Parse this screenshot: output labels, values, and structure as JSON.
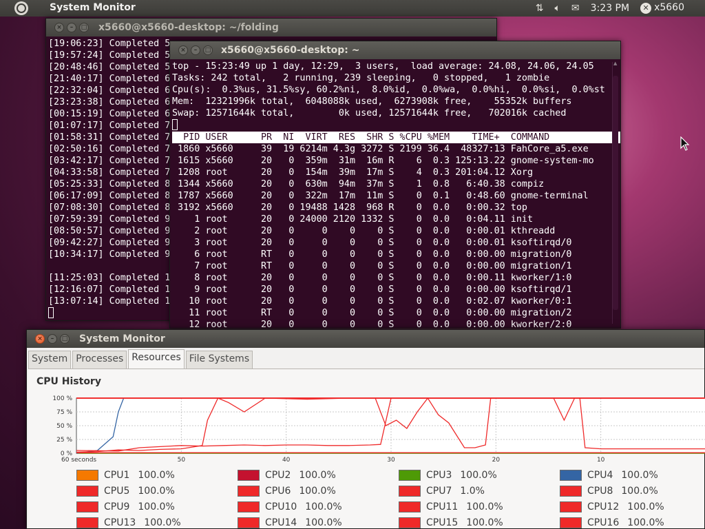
{
  "top_panel": {
    "app_title": "System Monitor",
    "time": "3:23 PM",
    "user": "x5660",
    "icons": [
      "network-icon",
      "volume-icon",
      "mail-icon",
      "session-icon"
    ]
  },
  "terminal_back": {
    "title": "x5660@x5660-desktop: ~/folding",
    "lines": [
      "[19:06:23] Completed 5",
      "[19:57:24] Completed 5",
      "[20:48:46] Completed 5",
      "[21:40:17] Completed 6",
      "[22:32:04] Completed 6",
      "[23:23:38] Completed 6",
      "[00:15:19] Completed 6",
      "[01:07:17] Completed 7",
      "[01:58:31] Completed 7",
      "[02:50:16] Completed 7",
      "[03:42:17] Completed 7",
      "[04:33:58] Completed 7",
      "[05:25:33] Completed 8",
      "[06:17:09] Completed 8",
      "[07:08:30] Completed 8",
      "[07:59:39] Completed 9",
      "[08:50:57] Completed 9",
      "[09:42:27] Completed 9",
      "[10:34:17] Completed 9",
      "",
      "[11:25:03] Completed 1",
      "[12:16:07] Completed 1",
      "[13:07:14] Completed 1"
    ]
  },
  "terminal_front": {
    "title": "x5660@x5660-desktop: ~",
    "summary": [
      "top - 15:23:49 up 1 day, 12:29,  3 users,  load average: 24.08, 24.06, 24.05",
      "Tasks: 242 total,   2 running, 239 sleeping,   0 stopped,   1 zombie",
      "Cpu(s):  0.3%us, 31.5%sy, 60.2%ni,  8.0%id,  0.0%wa,  0.0%hi,  0.0%si,  0.0%st",
      "Mem:  12321996k total,  6048088k used,  6273908k free,    55352k buffers",
      "Swap: 12571644k total,        0k used, 12571644k free,   702016k cached"
    ],
    "header": "  PID USER      PR  NI  VIRT  RES  SHR S %CPU %MEM    TIME+  COMMAND",
    "processes": [
      " 1860 x5660     39  19 6214m 4.3g 3272 S 2199 36.4  48327:13 FahCore_a5.exe",
      " 1615 x5660     20   0  359m  31m  16m R    6  0.3 125:13.22 gnome-system-mo",
      " 1208 root      20   0  154m  39m  17m S    4  0.3 201:04.12 Xorg",
      " 1344 x5660     20   0  630m  94m  37m S    1  0.8   6:40.38 compiz",
      " 1787 x5660     20   0  322m  17m  11m S    0  0.1   0:48.60 gnome-terminal",
      " 3192 x5660     20   0 19488 1428  968 R    0  0.0   0:00.32 top",
      "    1 root      20   0 24000 2120 1332 S    0  0.0   0:04.11 init",
      "    2 root      20   0     0    0    0 S    0  0.0   0:00.01 kthreadd",
      "    3 root      20   0     0    0    0 S    0  0.0   0:00.01 ksoftirqd/0",
      "    6 root      RT   0     0    0    0 S    0  0.0   0:00.00 migration/0",
      "    7 root      RT   0     0    0    0 S    0  0.0   0:00.00 migration/1",
      "    8 root      20   0     0    0    0 S    0  0.0   0:00.11 kworker/1:0",
      "    9 root      20   0     0    0    0 S    0  0.0   0:00.00 ksoftirqd/1",
      "   10 root      20   0     0    0    0 S    0  0.0   0:02.07 kworker/0:1",
      "   11 root      RT   0     0    0    0 S    0  0.0   0:00.00 migration/2",
      "   12 root      20   0     0    0    0 S    0  0.0   0:00.00 kworker/2:0"
    ]
  },
  "sysmon": {
    "title": "System Monitor",
    "tabs": [
      {
        "label": "System",
        "active": false
      },
      {
        "label": "Processes",
        "active": false
      },
      {
        "label": "Resources",
        "active": true
      },
      {
        "label": "File Systems",
        "active": false
      }
    ],
    "section_title": "CPU History"
  },
  "chart_data": {
    "type": "line",
    "title": "CPU History",
    "y_ticks": [
      "100 %",
      "75 %",
      "50 %",
      "25 %",
      "0 %"
    ],
    "x_ticks": [
      "60 seconds",
      "50",
      "40",
      "30",
      "20",
      "10"
    ],
    "xlim": [
      60,
      0
    ],
    "ylim": [
      0,
      100
    ],
    "grid": true,
    "series": [
      {
        "name": "CPU1",
        "color": "#f57900",
        "value_label": "100.0%",
        "x": [
          60,
          57.5,
          57,
          56.5,
          0
        ],
        "values": [
          0,
          0,
          0,
          0,
          0
        ]
      },
      {
        "name": "CPU2",
        "color": "#c4122f",
        "value_label": "100.0%",
        "x": [
          60,
          0
        ],
        "values": [
          0,
          0
        ]
      },
      {
        "name": "CPU3",
        "color": "#4e9a06",
        "value_label": "100.0%",
        "x": [
          60,
          0
        ],
        "values": [
          0,
          0
        ]
      },
      {
        "name": "CPU4",
        "color": "#3465a4",
        "value_label": "100.0%",
        "x": [
          60,
          58,
          56.5,
          56,
          55.5
        ],
        "values": [
          0,
          5,
          30,
          75,
          100
        ]
      },
      {
        "name": "CPU5",
        "color": "#ef2929",
        "value_label": "100.0%",
        "x": [
          60,
          58,
          56,
          54,
          52,
          50,
          48,
          47.5,
          46.5,
          45.5,
          44,
          42,
          38,
          34,
          31.5,
          30.5,
          29.5,
          28.5,
          27.5,
          26.5,
          25.5,
          24.5,
          23,
          22,
          21,
          20.5,
          19.5,
          18.5,
          17,
          15.5,
          14.5,
          13.5,
          12.5,
          12,
          11.5,
          10,
          8,
          6,
          4,
          2,
          0
        ],
        "values": [
          2,
          3,
          6,
          5,
          7,
          8,
          14,
          60,
          100,
          92,
          75,
          100,
          98,
          100,
          100,
          50,
          60,
          45,
          75,
          100,
          70,
          55,
          10,
          10,
          15,
          100,
          100,
          100,
          100,
          100,
          100,
          60,
          100,
          100,
          10,
          8,
          8,
          8,
          8,
          8,
          8
        ]
      },
      {
        "name": "CPU6",
        "color": "#ef2929",
        "value_label": "100.0%",
        "x": [
          60,
          56,
          54,
          52,
          50,
          48,
          46,
          44,
          42,
          40,
          38,
          36,
          34,
          32,
          31,
          30,
          29.5,
          28,
          26,
          24,
          22,
          20,
          18,
          16,
          14,
          12,
          10,
          8,
          6,
          4,
          2,
          0
        ],
        "values": [
          5,
          4,
          10,
          12,
          14,
          13,
          14,
          15,
          14,
          15,
          15,
          14,
          14,
          15,
          16,
          100,
          100,
          100,
          100,
          100,
          100,
          100,
          100,
          100,
          100,
          100,
          100,
          100,
          100,
          100,
          100,
          100
        ]
      },
      {
        "name": "CPU7",
        "color": "#ef2929",
        "value_label": "1.0%",
        "x": [
          60,
          0
        ],
        "values": [
          1,
          1
        ]
      },
      {
        "name": "CPU8",
        "color": "#ef2929",
        "value_label": "100.0%",
        "x": [
          60,
          0
        ],
        "values": [
          100,
          100
        ]
      },
      {
        "name": "CPU9",
        "color": "#ef2929",
        "value_label": "100.0%",
        "x": [
          60,
          0
        ],
        "values": [
          100,
          100
        ]
      },
      {
        "name": "CPU10",
        "color": "#ef2929",
        "value_label": "100.0%",
        "x": [
          60,
          0
        ],
        "values": [
          100,
          100
        ]
      },
      {
        "name": "CPU11",
        "color": "#ef2929",
        "value_label": "100.0%",
        "x": [
          60,
          0
        ],
        "values": [
          100,
          100
        ]
      },
      {
        "name": "CPU12",
        "color": "#ef2929",
        "value_label": "100.0%",
        "x": [
          60,
          0
        ],
        "values": [
          100,
          100
        ]
      },
      {
        "name": "CPU13",
        "color": "#ef2929",
        "value_label": "100.0%",
        "x": [
          60,
          0
        ],
        "values": [
          100,
          100
        ]
      },
      {
        "name": "CPU14",
        "color": "#ef2929",
        "value_label": "100.0%",
        "x": [
          60,
          0
        ],
        "values": [
          100,
          100
        ]
      },
      {
        "name": "CPU15",
        "color": "#ef2929",
        "value_label": "100.0%",
        "x": [
          60,
          0
        ],
        "values": [
          100,
          100
        ]
      },
      {
        "name": "CPU16",
        "color": "#ef2929",
        "value_label": "100.0%",
        "x": [
          60,
          0
        ],
        "values": [
          100,
          100
        ]
      }
    ]
  }
}
